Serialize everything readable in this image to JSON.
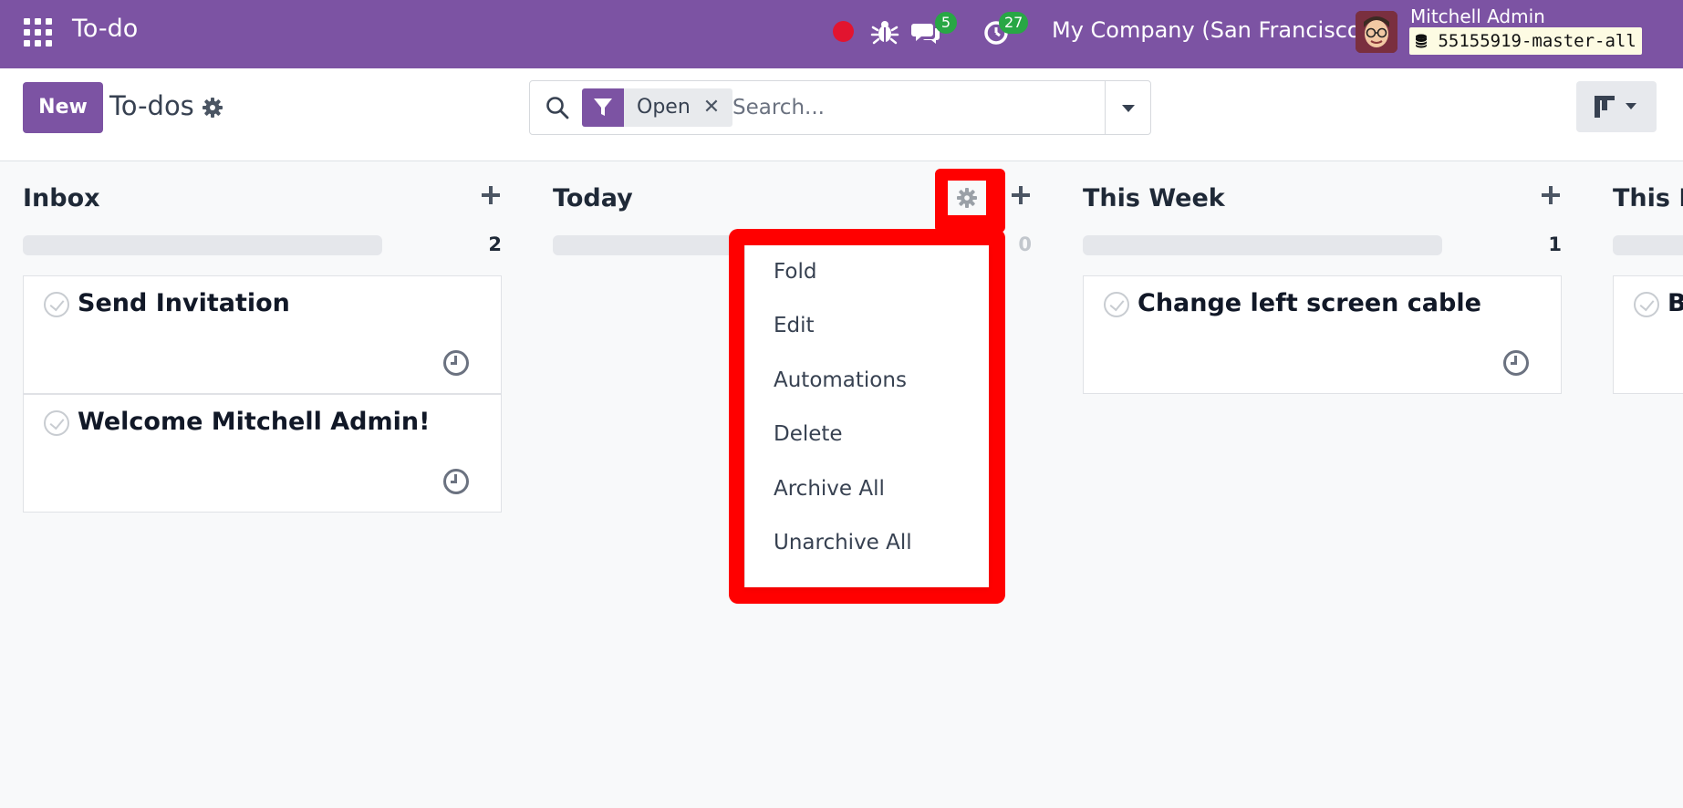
{
  "navbar": {
    "app_title": "To-do",
    "messages_badge": "5",
    "activities_badge": "27",
    "company": "My Company (San Francisco)",
    "user_name": "Mitchell Admin",
    "database": "55155919-master-all"
  },
  "control": {
    "new_label": "New",
    "page_title": "To-dos",
    "filter_facet": "Open",
    "search_placeholder": "Search..."
  },
  "kanban": {
    "columns": [
      {
        "title": "Inbox",
        "count": "2",
        "cards": [
          "Send Invitation",
          "Welcome Mitchell Admin!"
        ]
      },
      {
        "title": "Today",
        "count": "0",
        "cards": []
      },
      {
        "title": "This Week",
        "count": "1",
        "cards": [
          "Change left screen cable"
        ]
      },
      {
        "title": "This M",
        "count": "",
        "cards": [
          "B"
        ]
      }
    ]
  },
  "column_menu": {
    "items": [
      "Fold",
      "Edit",
      "Automations",
      "Delete",
      "Archive All",
      "Unarchive All"
    ]
  },
  "colors": {
    "brand": "#7c53a3",
    "highlight": "#ff0000",
    "badge": "#28a745"
  }
}
